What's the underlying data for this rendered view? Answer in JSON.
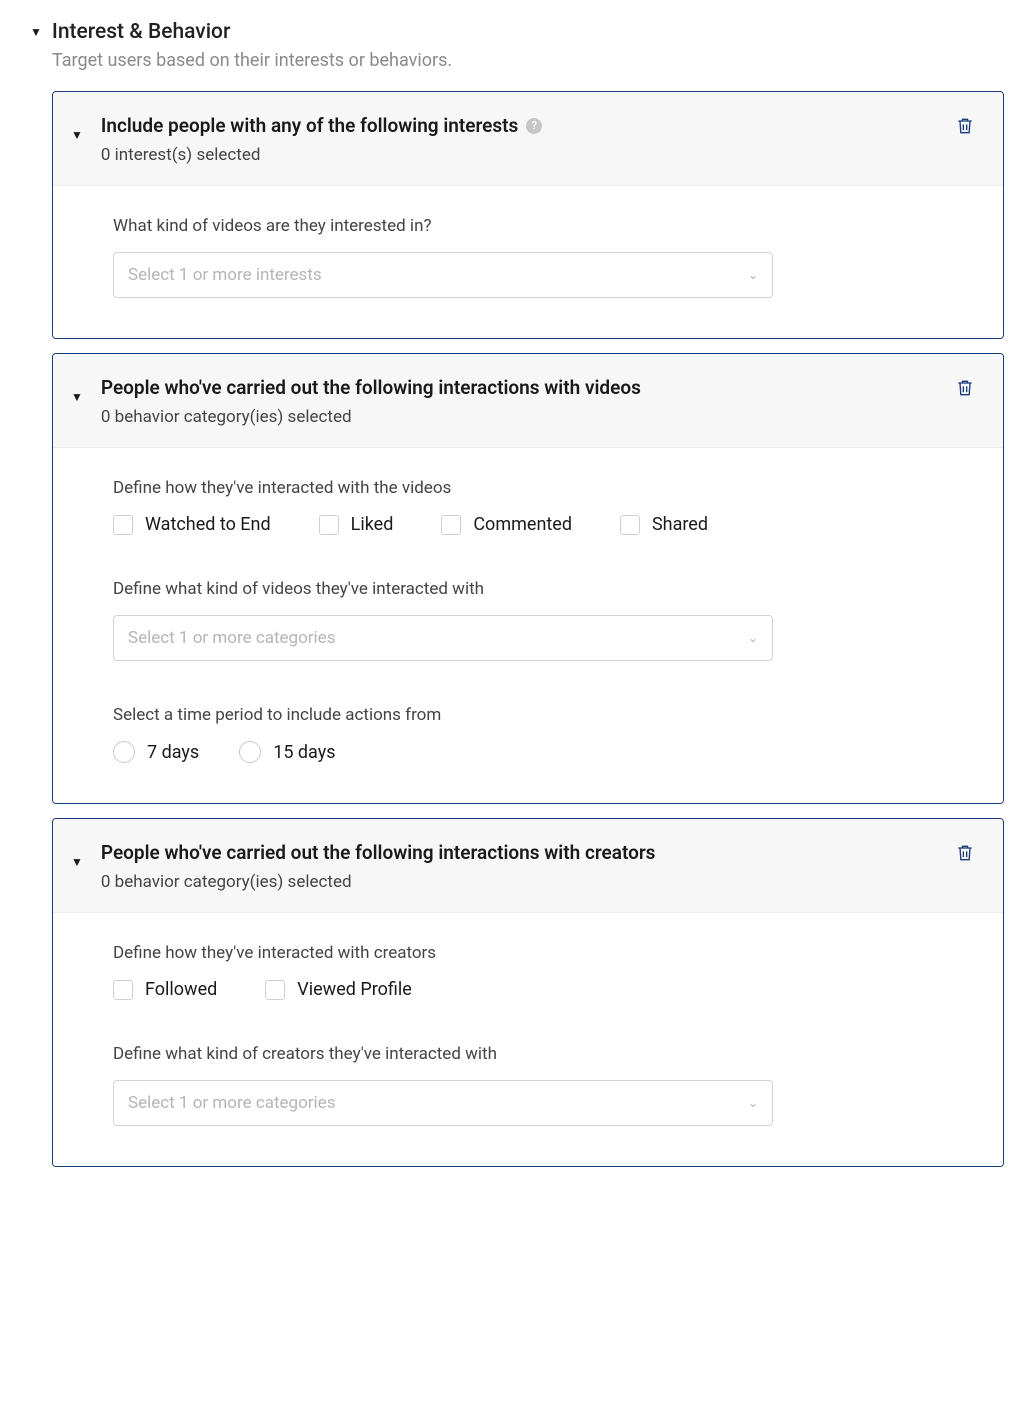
{
  "section": {
    "title": "Interest & Behavior",
    "subtitle": "Target users based on their interests or behaviors."
  },
  "cards": {
    "interests": {
      "title": "Include people with any of the following interests",
      "sub": "0 interest(s) selected",
      "q1": "What kind of videos are they interested in?",
      "placeholder": "Select 1 or more interests"
    },
    "videos": {
      "title": "People who've carried out the following interactions with videos",
      "sub": "0 behavior category(ies) selected",
      "q1": "Define how they've interacted with the videos",
      "checks": {
        "watched": "Watched to End",
        "liked": "Liked",
        "commented": "Commented",
        "shared": "Shared"
      },
      "q2": "Define what kind of videos they've interacted with",
      "placeholder": "Select 1 or more categories",
      "q3": "Select a time period to include actions from",
      "radios": {
        "r7": "7 days",
        "r15": "15 days"
      }
    },
    "creators": {
      "title": "People who've carried out the following interactions with creators",
      "sub": "0 behavior category(ies) selected",
      "q1": "Define how they've interacted with creators",
      "checks": {
        "followed": "Followed",
        "viewed": "Viewed Profile"
      },
      "q2": "Define what kind of creators they've interacted with",
      "placeholder": "Select 1 or more categories"
    }
  }
}
